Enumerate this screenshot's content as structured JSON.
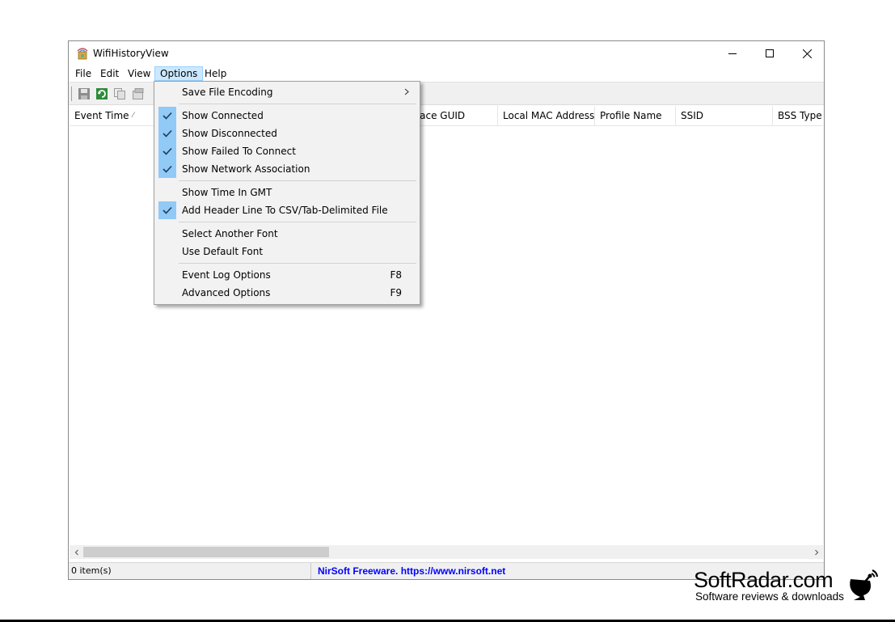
{
  "window": {
    "title": "WifiHistoryView",
    "controls": {
      "minimize": "minimize",
      "maximize": "maximize",
      "close": "close"
    }
  },
  "menubar": {
    "items": [
      {
        "label": "File"
      },
      {
        "label": "Edit"
      },
      {
        "label": "View"
      },
      {
        "label": "Options",
        "active": true
      },
      {
        "label": "Help"
      }
    ]
  },
  "toolbar": {
    "icons": [
      "save-icon",
      "refresh-icon",
      "copy-icon",
      "properties-icon"
    ]
  },
  "list": {
    "columns": [
      {
        "label": "Event Time",
        "sorted": "ascending"
      },
      {
        "label": "rface GUID"
      },
      {
        "label": "Local MAC Address"
      },
      {
        "label": "Profile Name"
      },
      {
        "label": "SSID"
      },
      {
        "label": "BSS Type"
      }
    ],
    "rows": []
  },
  "options_menu": {
    "items": [
      {
        "label": "Save File Encoding",
        "submenu": true
      },
      {
        "label": "Show Connected",
        "checked": true
      },
      {
        "label": "Show Disconnected",
        "checked": true
      },
      {
        "label": "Show Failed To Connect",
        "checked": true
      },
      {
        "label": "Show Network Association",
        "checked": true
      },
      {
        "label": "Show Time In GMT",
        "checked": false
      },
      {
        "label": "Add Header Line To CSV/Tab-Delimited File",
        "checked": true
      },
      {
        "label": "Select Another Font"
      },
      {
        "label": "Use Default Font"
      },
      {
        "label": "Event Log Options",
        "shortcut": "F8"
      },
      {
        "label": "Advanced Options",
        "shortcut": "F9"
      }
    ]
  },
  "statusbar": {
    "count": "0 item(s)",
    "link": "NirSoft Freeware. https://www.nirsoft.net"
  },
  "watermark": {
    "name": "SoftRadar.com",
    "tagline": "Software reviews & downloads"
  },
  "colors": {
    "menu_active_bg": "#cce8ff",
    "check_bg": "#91c9f7",
    "link": "#0000ff"
  }
}
